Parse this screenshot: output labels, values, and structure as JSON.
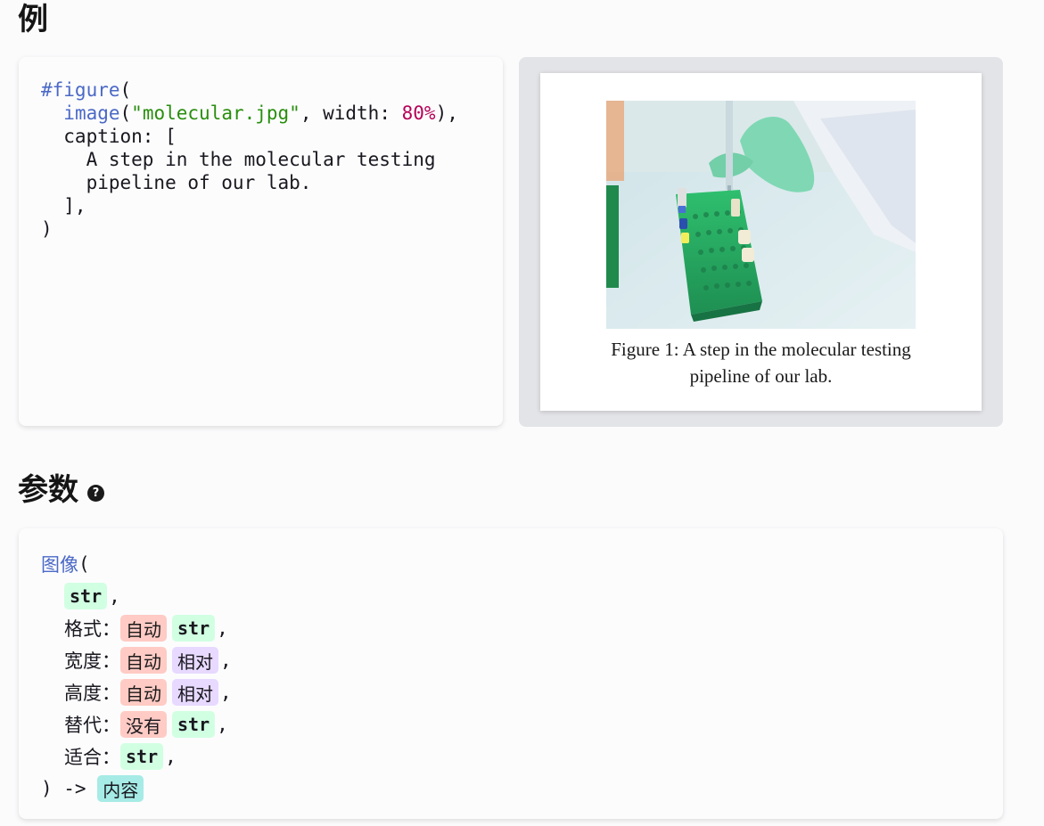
{
  "example_heading": "例",
  "params_heading": "参数",
  "help_icon_glyph": "?",
  "code": {
    "line1_kw": "#figure",
    "line1_rest": "(",
    "line2_indent": "  ",
    "line2_kw": "image",
    "line2_p1": "(",
    "line2_str": "\"molecular.jpg\"",
    "line2_p2": ", width: ",
    "line2_num": "80%",
    "line2_p3": "),",
    "line3": "  caption: [",
    "line4": "    A step in the molecular testing",
    "line5": "    pipeline of our lab.",
    "line6": "  ],",
    "line7": ")"
  },
  "preview": {
    "caption_line1": "Figure 1:  A step in the molecular testing",
    "caption_line2": "pipeline of our lab."
  },
  "signature": {
    "fn_name": "图像",
    "open_paren": "(",
    "params": [
      {
        "label": "",
        "types": [
          {
            "text": "str",
            "kind": "str"
          }
        ]
      },
      {
        "label": "格式：",
        "types": [
          {
            "text": "自动",
            "kind": "auto"
          },
          {
            "text": "str",
            "kind": "str"
          }
        ]
      },
      {
        "label": "宽度：",
        "types": [
          {
            "text": "自动",
            "kind": "auto"
          },
          {
            "text": "相对",
            "kind": "rel"
          }
        ]
      },
      {
        "label": "高度：",
        "types": [
          {
            "text": "自动",
            "kind": "auto"
          },
          {
            "text": "相对",
            "kind": "rel"
          }
        ]
      },
      {
        "label": "替代：",
        "types": [
          {
            "text": "没有",
            "kind": "none"
          },
          {
            "text": "str",
            "kind": "str"
          }
        ]
      },
      {
        "label": "适合：",
        "types": [
          {
            "text": "str",
            "kind": "str"
          }
        ]
      }
    ],
    "comma": ",",
    "close": ") -> ",
    "return_type": "内容"
  },
  "colors": {
    "keyword": "#4b69c6",
    "string": "#298e0d",
    "number": "#b60157",
    "type_str_bg": "#d1ffe2",
    "type_auto_bg": "#ffcbc4",
    "type_rel_bg": "#e7d9ff",
    "type_content_bg": "#a6ebe6"
  }
}
